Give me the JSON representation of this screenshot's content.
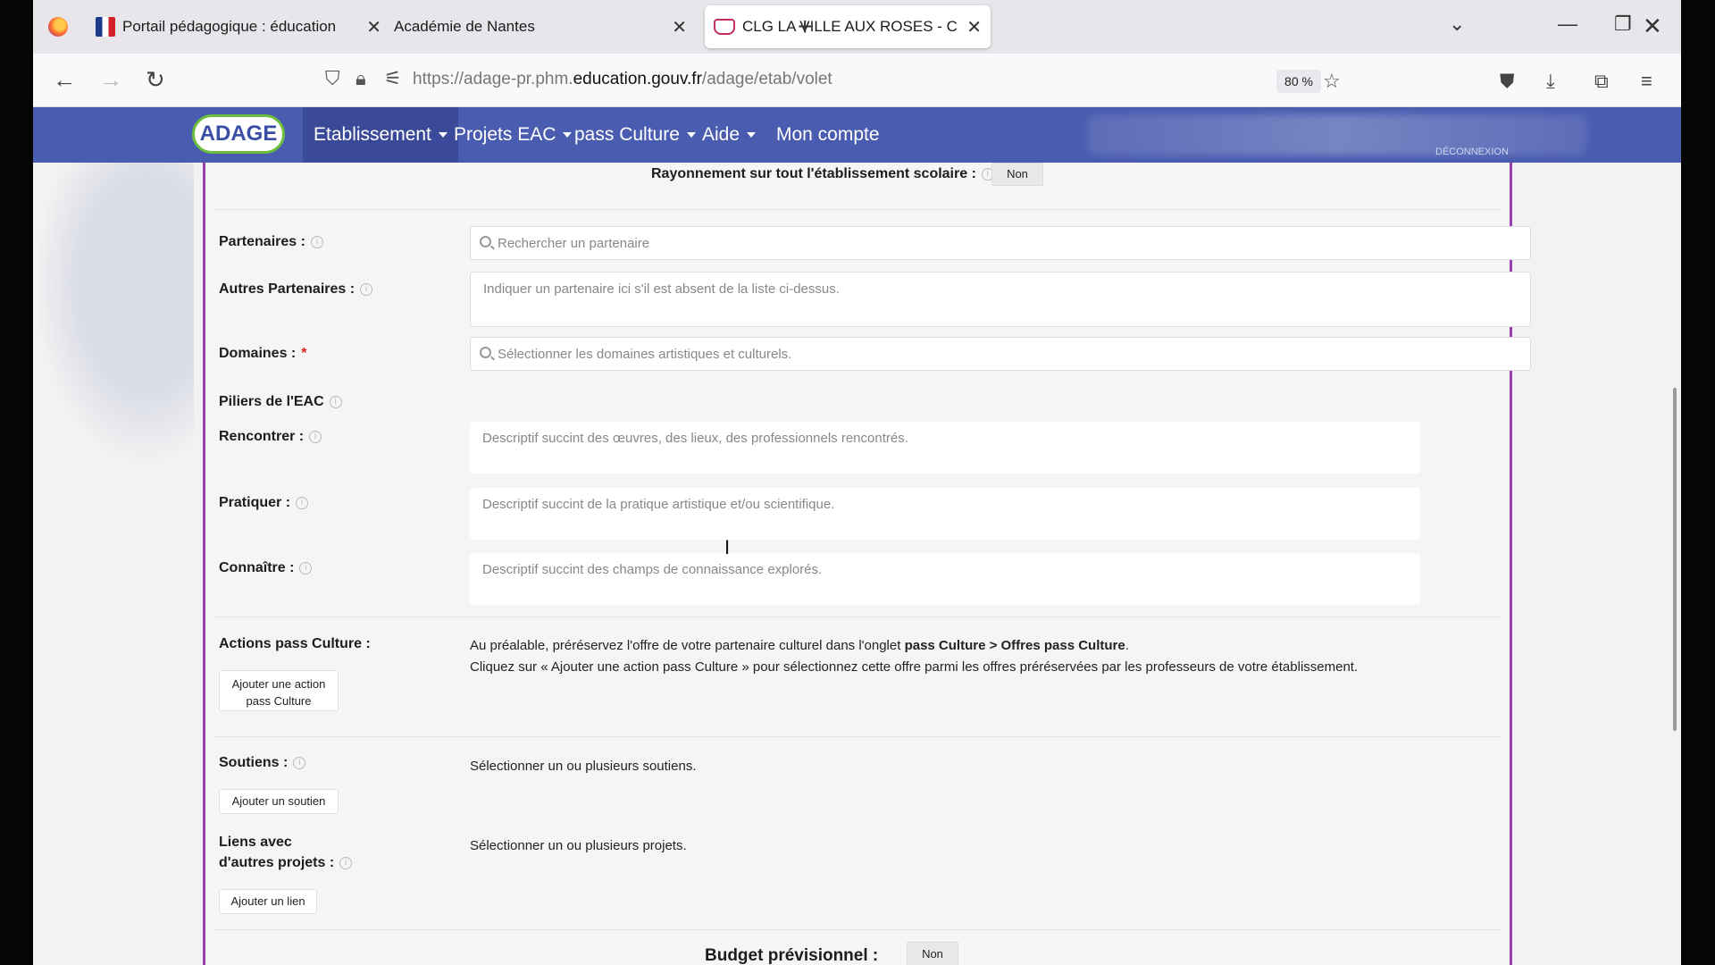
{
  "browser": {
    "tabs": [
      {
        "label": "Portail pédagogique : éducation"
      },
      {
        "label": "Académie de Nantes"
      },
      {
        "label": "CLG LA VILLE AUX ROSES - CHA"
      }
    ],
    "url_prefix": "https://adage-pr.phm.",
    "url_domain": "education.gouv.fr",
    "url_path": "/adage/etab/volet",
    "zoom": "80 %"
  },
  "app": {
    "logo": "ADAGE",
    "menu": [
      {
        "label": "Etablissement"
      },
      {
        "label": "Projets EAC"
      },
      {
        "label": "pass Culture"
      },
      {
        "label": "Aide"
      },
      {
        "label": "Mon compte"
      }
    ],
    "logout": "DÉCONNEXION"
  },
  "form": {
    "rayonnement_label": "Rayonnement sur tout l'établissement scolaire :",
    "rayonnement_value": "Non",
    "partenaires_label": "Partenaires :",
    "partenaires_placeholder": "Rechercher un partenaire",
    "autres_label": "Autres Partenaires :",
    "autres_placeholder": "Indiquer un partenaire ici s'il est absent de la liste ci-dessus.",
    "domaines_label": "Domaines :",
    "domaines_placeholder": "Sélectionner les domaines artistiques et culturels.",
    "piliers_label": "Piliers de l'EAC",
    "rencontrer_label": "Rencontrer :",
    "rencontrer_placeholder": "Descriptif succint des œuvres, des lieux, des professionnels rencontrés.",
    "pratiquer_label": "Pratiquer :",
    "pratiquer_placeholder": "Descriptif succint de la pratique artistique et/ou scientifique.",
    "connaitre_label": "Connaître :",
    "connaitre_placeholder": "Descriptif succint des champs de connaissance explorés.",
    "actions_label": "Actions pass Culture :",
    "actions_button": "Ajouter une action pass Culture",
    "actions_text1_a": "Au préalable, préréservez l'offre de votre partenaire culturel dans l'onglet ",
    "actions_text1_b": "pass Culture > Offres pass Culture",
    "actions_text1_c": ".",
    "actions_text2": "Cliquez sur « Ajouter une action pass Culture » pour sélectionnez cette offre parmi les offres préréservées par les professeurs de votre établissement.",
    "soutiens_label": "Soutiens :",
    "soutiens_text": "Sélectionner un ou plusieurs soutiens.",
    "soutiens_button": "Ajouter un soutien",
    "liens_label_1": "Liens avec",
    "liens_label_2": "d'autres projets :",
    "liens_text": "Sélectionner un ou plusieurs projets.",
    "liens_button": "Ajouter un lien",
    "budget_label": "Budget prévisionnel :",
    "budget_value": "Non"
  }
}
